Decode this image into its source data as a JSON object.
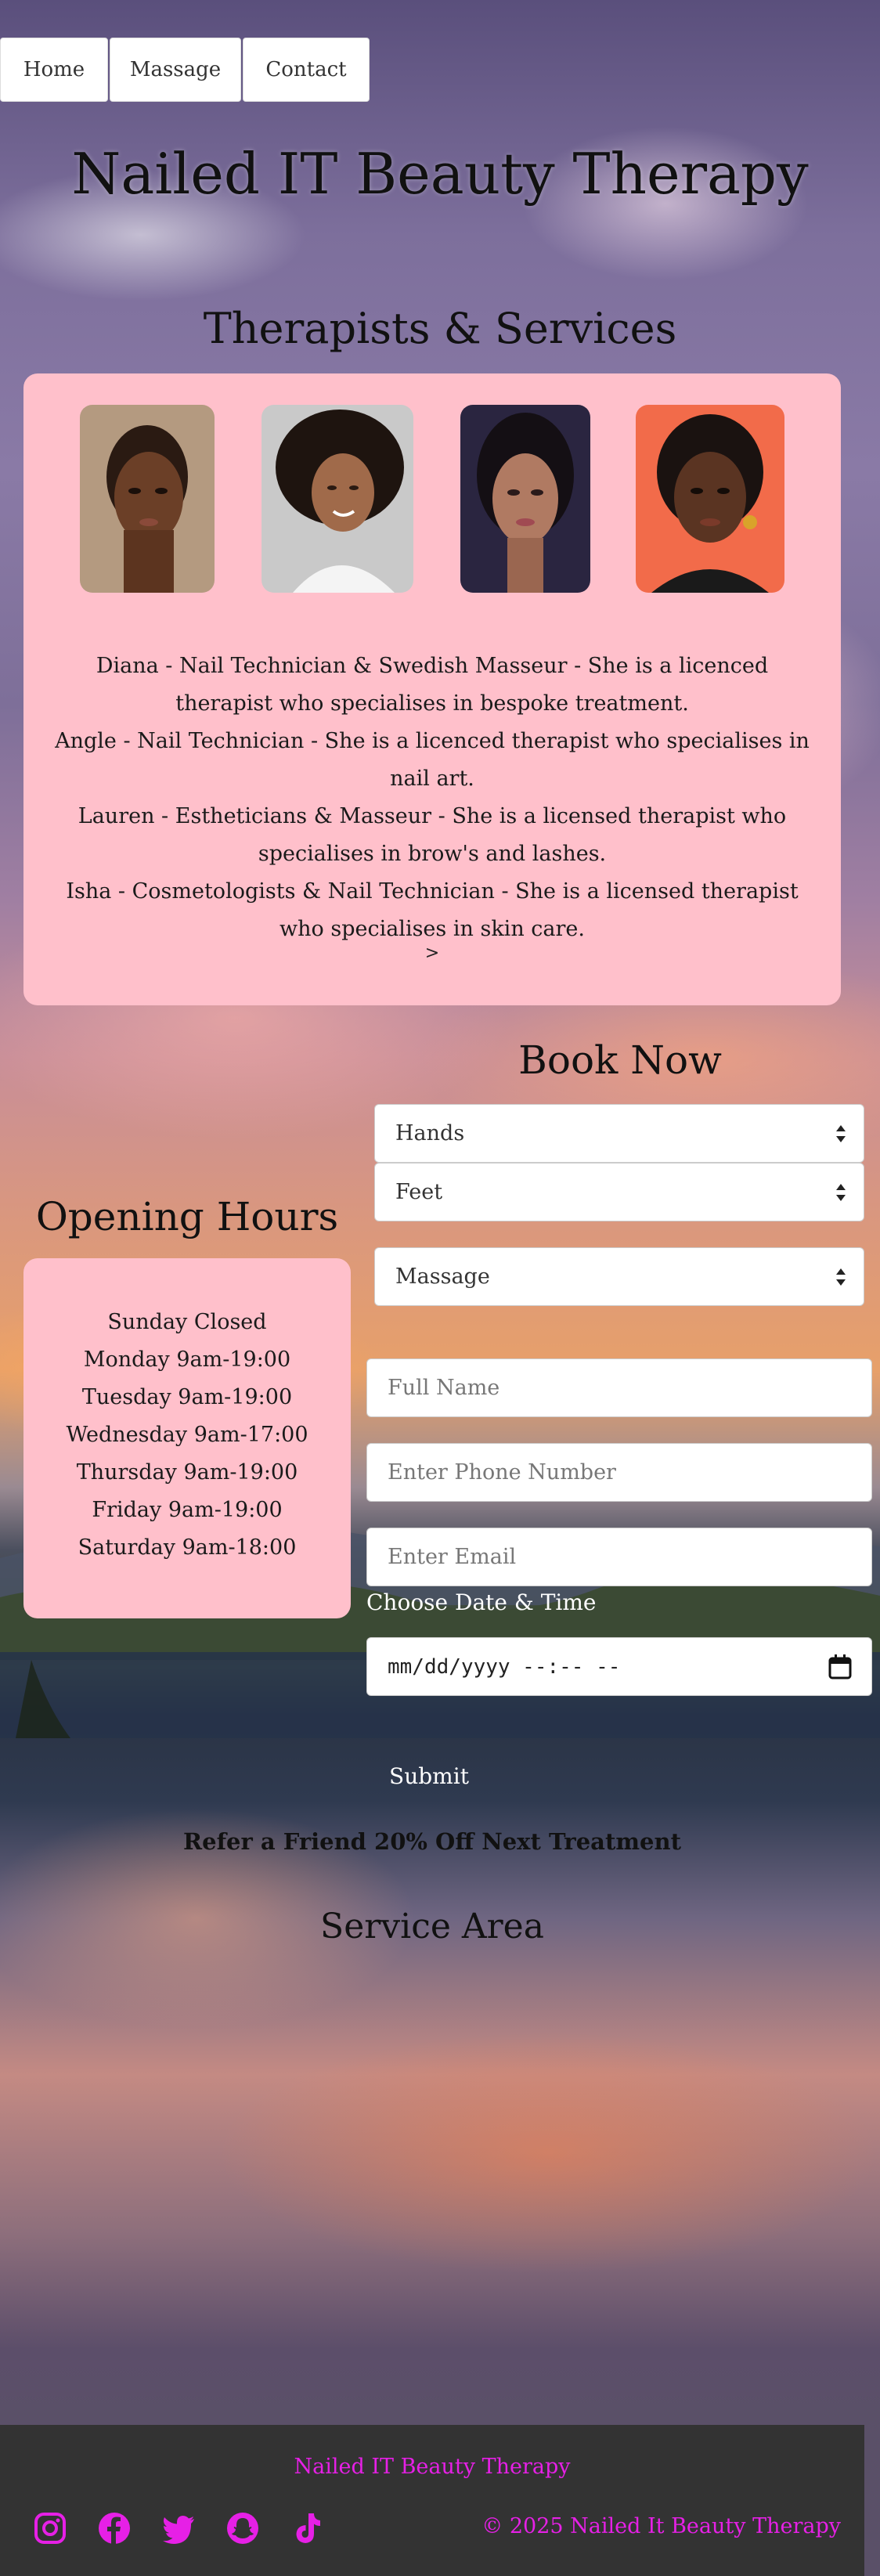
{
  "nav": {
    "home": "Home",
    "massage": "Massage",
    "contact": "Contact"
  },
  "site_title": "Nailed IT Beauty Therapy",
  "therapists": {
    "title": "Therapists & Services",
    "lines": [
      "Diana - Nail Technician & Swedish Masseur - She is a licenced therapist who specialises in bespoke treatment.",
      "Angle - Nail Technician - She is a licenced therapist who specialises in nail art.",
      "Lauren - Estheticians & Masseur - She is a licensed therapist who specialises in brow's and lashes.",
      "Isha - Cosmetologists & Nail Technician - She is a licensed therapist who specialises in skin care."
    ],
    "next": ">"
  },
  "hours": {
    "title": "Opening Hours",
    "lines": [
      "Sunday Closed",
      "Monday 9am-19:00",
      "Tuesday 9am-19:00",
      "Wednesday 9am-17:00",
      "Thursday 9am-19:00",
      "Friday 9am-19:00",
      "Saturday 9am-18:00"
    ]
  },
  "booking": {
    "title": "Book Now",
    "select_hands": "Hands",
    "select_feet": "Feet",
    "select_massage": "Massage",
    "name_placeholder": "Full Name",
    "phone_placeholder": "Enter Phone Number",
    "email_placeholder": "Enter Email",
    "date_label": "Choose Date & Time",
    "date_value": "mm/dd/yyyy --:-- --",
    "submit": "Submit"
  },
  "referral": "Refer a Friend 20% Off Next Treatment",
  "service_area": "Service Area",
  "footer": {
    "brand": "Nailed IT Beauty Therapy",
    "copyright": "© 2025 Nailed It Beauty Therapy",
    "icons": [
      "instagram-icon",
      "facebook-icon",
      "twitter-icon",
      "snapchat-icon",
      "tiktok-icon"
    ]
  },
  "colors": {
    "card": "#ffc0cb",
    "footer_bg": "#333333",
    "footer_accent": "#e620e6"
  }
}
